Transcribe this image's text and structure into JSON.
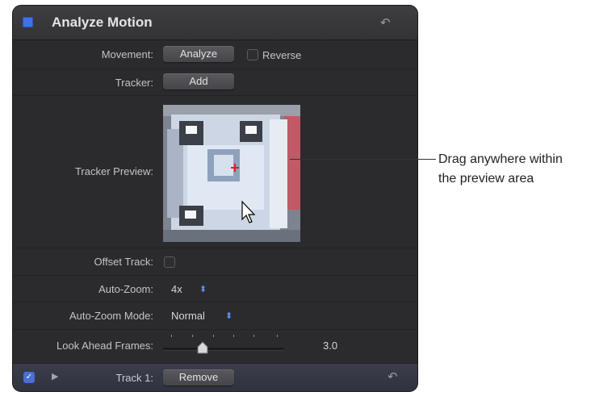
{
  "header": {
    "title": "Analyze Motion",
    "reset_icon": "reset-arrow-icon"
  },
  "movement": {
    "label": "Movement:",
    "button": "Analyze",
    "reverse_label": "Reverse"
  },
  "tracker": {
    "label": "Tracker:",
    "button": "Add"
  },
  "tracker_preview": {
    "label": "Tracker Preview:"
  },
  "offset_track": {
    "label": "Offset Track:"
  },
  "auto_zoom": {
    "label": "Auto-Zoom:",
    "value": "4x"
  },
  "auto_zoom_mode": {
    "label": "Auto-Zoom Mode:",
    "value": "Normal"
  },
  "look_ahead": {
    "label": "Look Ahead Frames:",
    "value": "3.0"
  },
  "track": {
    "label": "Track 1:",
    "button": "Remove"
  },
  "callout": {
    "line1": "Drag anywhere within",
    "line2": "the preview area"
  },
  "colors": {
    "accent": "#3d73e8",
    "panel": "#2b2b2d"
  }
}
